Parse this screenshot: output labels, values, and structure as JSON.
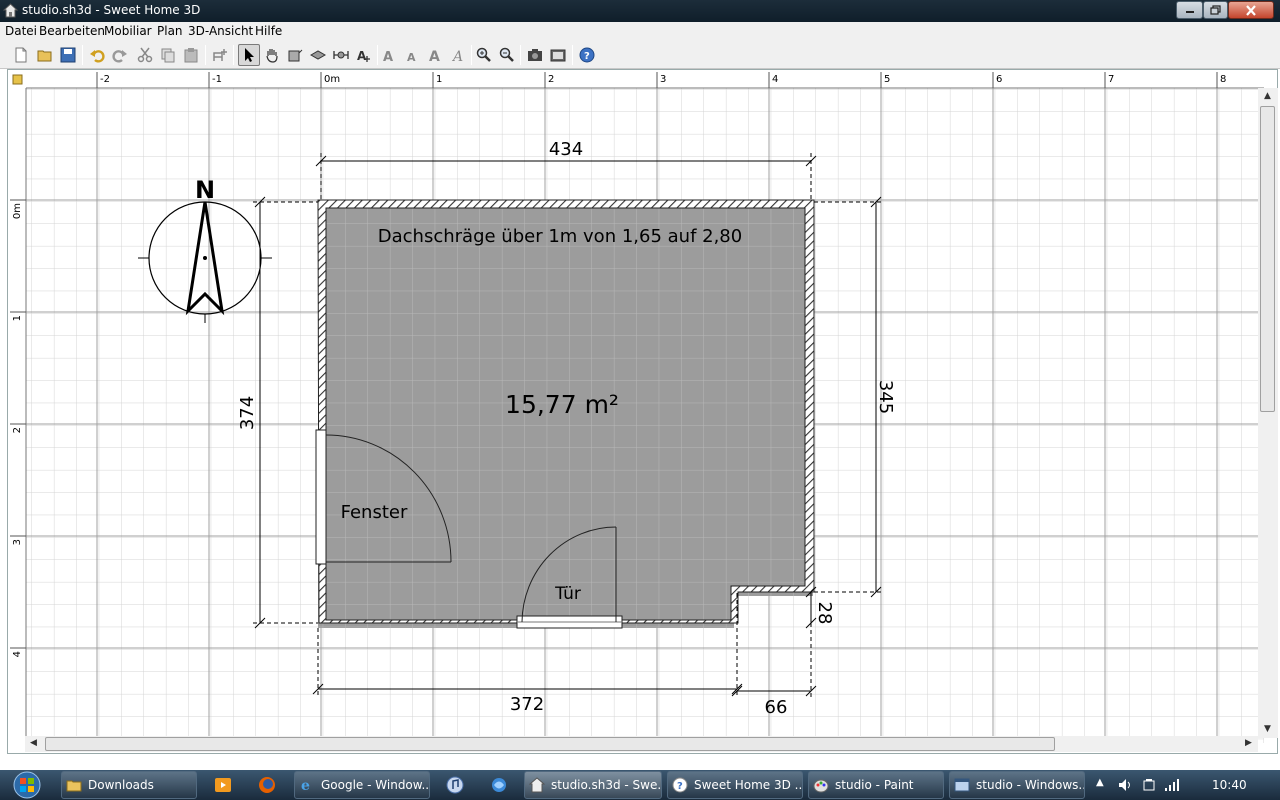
{
  "window": {
    "title": "studio.sh3d - Sweet Home 3D"
  },
  "menu": [
    "Datei",
    "Bearbeiten",
    "Mobiliar",
    "Plan",
    "3D-Ansicht",
    "Hilfe"
  ],
  "toolbar": {
    "buttons": [
      "new-icon",
      "open-icon",
      "save-icon",
      "undo-icon",
      "redo-icon",
      "cut-icon",
      "copy-icon",
      "paste-icon",
      "add-furniture-icon",
      "select-icon",
      "pan-icon",
      "create-walls-icon",
      "create-rooms-icon",
      "create-dimensions-icon",
      "add-text-icon",
      "increase-text-icon",
      "decrease-text-icon",
      "bold-icon",
      "italic-icon",
      "zoom-in-icon",
      "zoom-out-icon",
      "create-photo-icon",
      "create-video-icon",
      "help-icon"
    ],
    "active": "select-icon"
  },
  "ruler": {
    "top": [
      "-2",
      "-1",
      "0m",
      "1",
      "2",
      "3",
      "4",
      "5",
      "6",
      "7",
      "8"
    ],
    "left": [
      "0m",
      "1",
      "2",
      "3",
      "4"
    ]
  },
  "plan": {
    "room_label": "Dachschräge über 1m von 1,65 auf 2,80",
    "room_area": "15,77 m²",
    "window_label": "Fenster",
    "door_label": "Tür",
    "dimensions": {
      "top": "434",
      "left": "374",
      "right": "345",
      "bottom": "372",
      "bottom_right": "66",
      "step": "28"
    },
    "compass_label": "N"
  },
  "taskbar": {
    "items": [
      {
        "label": "Downloads",
        "icon": "folder-icon"
      },
      {
        "label": "Google - Window...",
        "icon": "ie-icon"
      },
      {
        "label": "studio.sh3d - Swe...",
        "icon": "sh3d-icon",
        "active": true
      },
      {
        "label": "Sweet Home 3D ...",
        "icon": "help-icon"
      },
      {
        "label": "studio - Paint",
        "icon": "paint-icon"
      },
      {
        "label": "studio - Windows...",
        "icon": "window-icon"
      }
    ],
    "clock": "10:40"
  }
}
